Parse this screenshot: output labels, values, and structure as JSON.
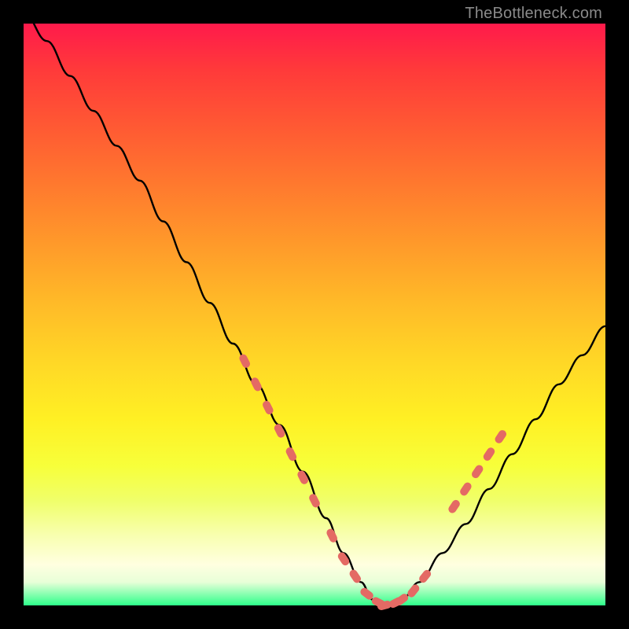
{
  "watermark": {
    "text": "TheBottleneck.com"
  },
  "colors": {
    "background": "#000000",
    "curve_stroke": "#000000",
    "marker_fill": "#e46a64",
    "marker_stroke": "#e46a64",
    "gradient_top": "#ff1a4b",
    "gradient_bottom": "#2dff8a"
  },
  "chart_data": {
    "type": "line",
    "title": "",
    "xlabel": "",
    "ylabel": "",
    "xlim": [
      0,
      100
    ],
    "ylim": [
      0,
      100
    ],
    "grid": false,
    "legend": false,
    "series": [
      {
        "name": "bottleneck-curve",
        "x": [
          0,
          4,
          8,
          12,
          16,
          20,
          24,
          28,
          32,
          36,
          40,
          44,
          48,
          52,
          55,
          58,
          60,
          62,
          65,
          68,
          72,
          76,
          80,
          84,
          88,
          92,
          96,
          100
        ],
        "y": [
          102,
          97,
          91,
          85,
          79,
          73,
          66,
          59,
          52,
          45,
          38,
          31,
          23,
          15,
          9,
          4,
          1,
          0,
          1,
          4,
          9,
          14,
          20,
          26,
          32,
          38,
          43,
          48
        ]
      }
    ],
    "markers": [
      {
        "name": "left-band",
        "x": [
          38,
          40,
          42,
          44,
          46,
          48,
          50
        ],
        "y": [
          42,
          38,
          34,
          30,
          26,
          22,
          18
        ]
      },
      {
        "name": "valley",
        "x": [
          53,
          55,
          57,
          59,
          61,
          62,
          64,
          65,
          67,
          69
        ],
        "y": [
          12,
          8,
          5,
          2,
          0.5,
          0,
          0.5,
          1,
          2.5,
          5
        ]
      },
      {
        "name": "right-band",
        "x": [
          74,
          76,
          78,
          80,
          82
        ],
        "y": [
          17,
          20,
          23,
          26,
          29
        ]
      }
    ]
  }
}
